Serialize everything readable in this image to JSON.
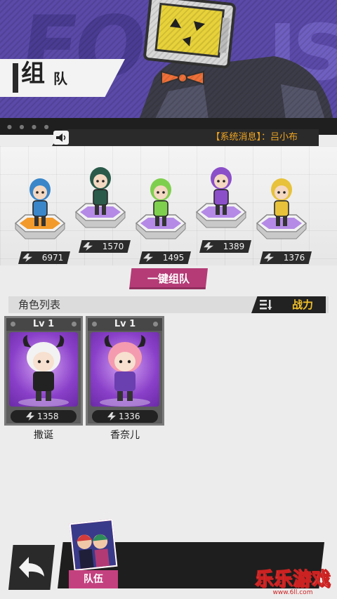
{
  "header": {
    "title_big": "组",
    "title_small": "队"
  },
  "system_message": {
    "text": "【系统消息】：吕小布"
  },
  "team_slots": [
    {
      "power": "6971",
      "pad_color": "#f29a2b",
      "skin": "#3a86c9"
    },
    {
      "power": "1570",
      "pad_color": "#b48ae6",
      "skin": "#2b5a4a"
    },
    {
      "power": "1495",
      "pad_color": "#b48ae6",
      "skin": "#7fcf4e"
    },
    {
      "power": "1389",
      "pad_color": "#b48ae6",
      "skin": "#8b4fc9"
    },
    {
      "power": "1376",
      "pad_color": "#b48ae6",
      "skin": "#e7c23a"
    }
  ],
  "auto_team_label": "一键组队",
  "list": {
    "title": "角色列表",
    "sort_label": "战力"
  },
  "roster": [
    {
      "level": "Lv 1",
      "power": "1358",
      "name": "撒诞"
    },
    {
      "level": "Lv 1",
      "power": "1336",
      "name": "香奈儿"
    }
  ],
  "bottom": {
    "team_label": "队伍"
  },
  "watermark": {
    "big": "乐乐游戏",
    "small": "www.6ll.com"
  },
  "colors": {
    "accent": "#b53b76",
    "gold": "#f3c22a",
    "banner": "#5b4aa8"
  }
}
